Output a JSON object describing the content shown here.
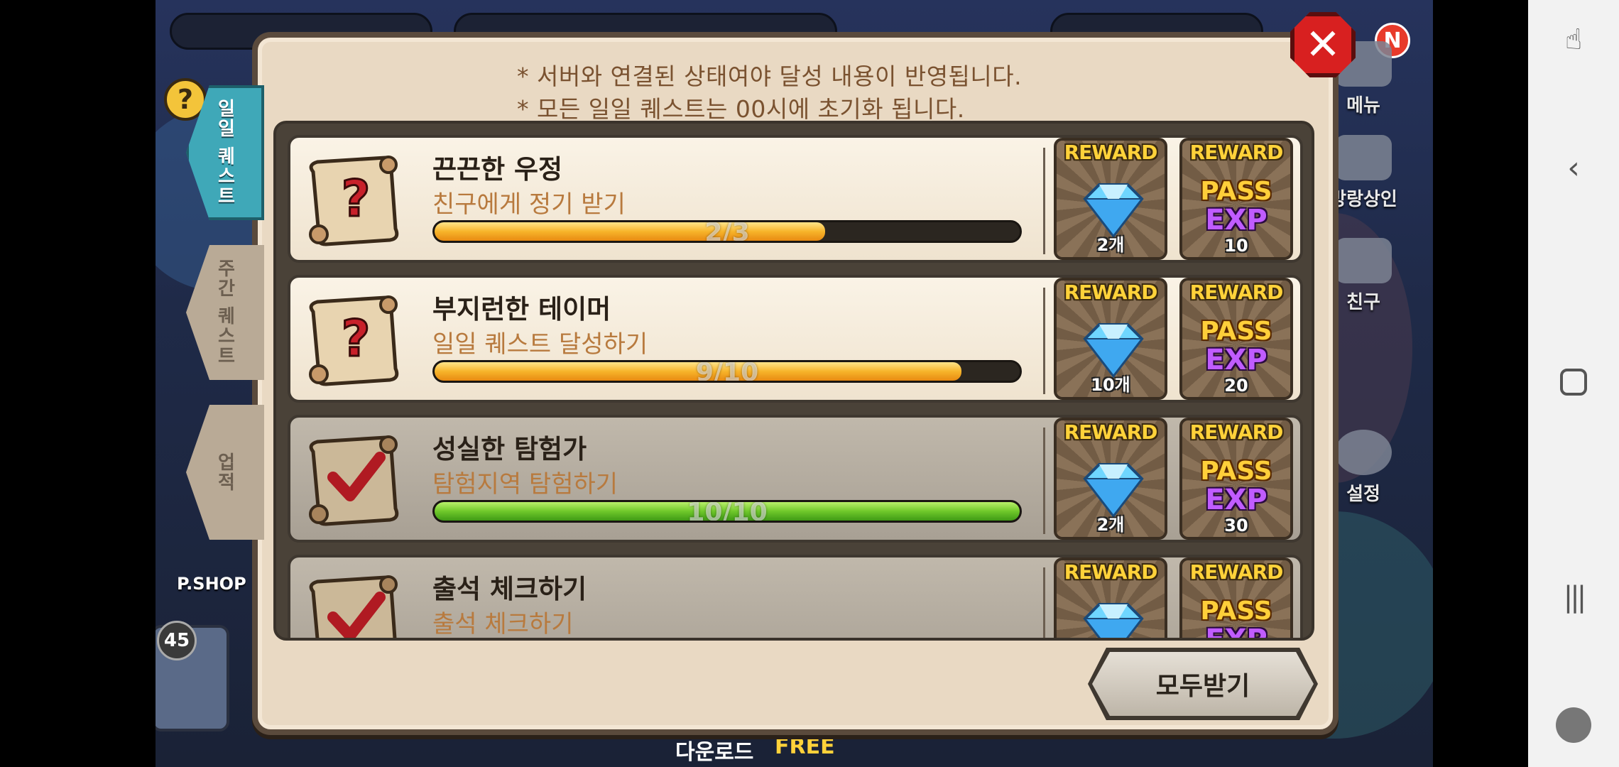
{
  "dialog": {
    "notices": [
      "* 서버와 연결된 상태여야 달성 내용이 반영됩니다.",
      "* 모든 일일 퀘스트는 00시에 초기화 됩니다."
    ],
    "claim_all_label": "모두받기",
    "close_icon": "close-icon"
  },
  "tabs": [
    {
      "label": "일일 퀘스트",
      "state": "active"
    },
    {
      "label": "주간 퀘스트",
      "state": "inactive"
    },
    {
      "label": "업적",
      "state": "inactive"
    }
  ],
  "reward_header": "REWARD",
  "pass_label": "PASS",
  "exp_label": "EXP",
  "quests": [
    {
      "title": "끈끈한 우정",
      "desc": "친구에게 정기 받기",
      "progress_text": "2/3",
      "progress": 0.667,
      "status": "in-progress",
      "gem_reward": "2개",
      "pass_exp": "10"
    },
    {
      "title": "부지런한 테이머",
      "desc": "일일 퀘스트 달성하기",
      "progress_text": "9/10",
      "progress": 0.9,
      "status": "in-progress",
      "gem_reward": "10개",
      "pass_exp": "20"
    },
    {
      "title": "성실한 탐험가",
      "desc": "탐험지역 탐험하기",
      "progress_text": "10/10",
      "progress": 1.0,
      "status": "complete",
      "gem_reward": "2개",
      "pass_exp": "30"
    },
    {
      "title": "출석 체크하기",
      "desc": "출석 체크하기",
      "progress_text": "",
      "progress": 1.0,
      "status": "complete",
      "gem_reward": "",
      "pass_exp": ""
    }
  ],
  "side_menu": [
    {
      "label": "메뉴"
    },
    {
      "label": "방랑상인"
    },
    {
      "label": "친구"
    },
    {
      "label": "설정"
    }
  ],
  "hud": {
    "level_badge": "45",
    "pshop_label": "P.SHOP",
    "new_badge": "N",
    "download_label": "다운로드",
    "free_label": "FREE"
  },
  "colors": {
    "accent_tab": "#3fa8b8",
    "progress_orange": "#f7b42a",
    "progress_green": "#6fc82a",
    "close_red": "#d82020"
  }
}
